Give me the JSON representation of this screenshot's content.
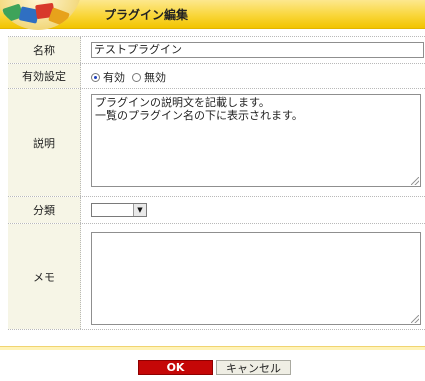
{
  "header": {
    "title": "プラグイン編集"
  },
  "form": {
    "name": {
      "label": "名称",
      "value": "テストプラグイン"
    },
    "status": {
      "label": "有効設定",
      "options": [
        "有効",
        "無効"
      ],
      "selected": "有効"
    },
    "description": {
      "label": "説明",
      "value": "プラグインの説明文を記載します。\n一覧のプラグイン名の下に表示されます。"
    },
    "category": {
      "label": "分類",
      "value": ""
    },
    "memo": {
      "label": "メモ",
      "value": ""
    }
  },
  "buttons": {
    "ok": "OK",
    "cancel": "キャンセル"
  },
  "colors": {
    "header": "#f9d63a",
    "ok_button": "#c50707",
    "label_bg": "#f6f5e6"
  }
}
